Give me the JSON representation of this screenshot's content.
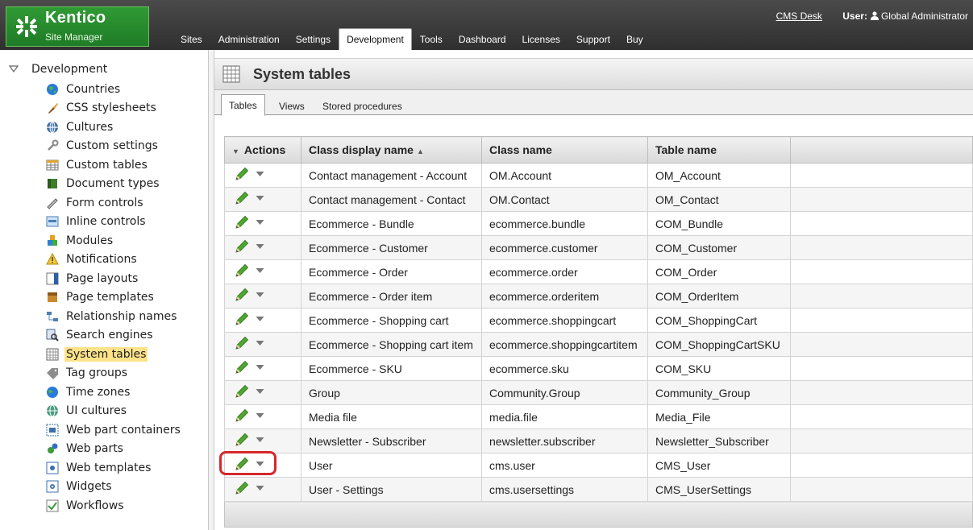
{
  "logo": {
    "title": "Kentico",
    "subtitle": "Site Manager"
  },
  "header": {
    "cms_desk": "CMS Desk",
    "user_label": "User:",
    "user_name": "Global Administrator",
    "nav": [
      {
        "label": "Sites",
        "active": false
      },
      {
        "label": "Administration",
        "active": false
      },
      {
        "label": "Settings",
        "active": false
      },
      {
        "label": "Development",
        "active": true
      },
      {
        "label": "Tools",
        "active": false
      },
      {
        "label": "Dashboard",
        "active": false
      },
      {
        "label": "Licenses",
        "active": false
      },
      {
        "label": "Support",
        "active": false
      },
      {
        "label": "Buy",
        "active": false
      }
    ]
  },
  "tree": {
    "root": "Development",
    "items": [
      {
        "label": "Countries",
        "icon": "globe-icon"
      },
      {
        "label": "CSS stylesheets",
        "icon": "brush-icon"
      },
      {
        "label": "Cultures",
        "icon": "culture-globe-icon"
      },
      {
        "label": "Custom settings",
        "icon": "wrench-icon"
      },
      {
        "label": "Custom tables",
        "icon": "table-icon"
      },
      {
        "label": "Document types",
        "icon": "book-icon"
      },
      {
        "label": "Form controls",
        "icon": "form-icon"
      },
      {
        "label": "Inline controls",
        "icon": "inline-control-icon"
      },
      {
        "label": "Modules",
        "icon": "modules-icon"
      },
      {
        "label": "Notifications",
        "icon": "warning-icon"
      },
      {
        "label": "Page layouts",
        "icon": "layout-icon"
      },
      {
        "label": "Page templates",
        "icon": "template-icon"
      },
      {
        "label": "Relationship names",
        "icon": "relationship-icon"
      },
      {
        "label": "Search engines",
        "icon": "search-engine-icon"
      },
      {
        "label": "System tables",
        "icon": "grid-icon",
        "selected": true
      },
      {
        "label": "Tag groups",
        "icon": "tag-icon"
      },
      {
        "label": "Time zones",
        "icon": "clock-globe-icon"
      },
      {
        "label": "UI cultures",
        "icon": "ui-culture-icon"
      },
      {
        "label": "Web part containers",
        "icon": "container-icon"
      },
      {
        "label": "Web parts",
        "icon": "webpart-icon"
      },
      {
        "label": "Web templates",
        "icon": "web-template-icon"
      },
      {
        "label": "Widgets",
        "icon": "widget-icon"
      },
      {
        "label": "Workflows",
        "icon": "workflow-icon"
      }
    ]
  },
  "page": {
    "title": "System tables"
  },
  "tabs": [
    {
      "label": "Tables",
      "active": true
    },
    {
      "label": "Views",
      "active": false
    },
    {
      "label": "Stored procedures",
      "active": false
    }
  ],
  "grid": {
    "headers": {
      "actions": "Actions",
      "display": "Class display name",
      "class": "Class name",
      "table": "Table name"
    },
    "rows": [
      {
        "display": "Contact management - Account",
        "class": "OM.Account",
        "table": "OM_Account"
      },
      {
        "display": "Contact management - Contact",
        "class": "OM.Contact",
        "table": "OM_Contact"
      },
      {
        "display": "Ecommerce - Bundle",
        "class": "ecommerce.bundle",
        "table": "COM_Bundle"
      },
      {
        "display": "Ecommerce - Customer",
        "class": "ecommerce.customer",
        "table": "COM_Customer"
      },
      {
        "display": "Ecommerce - Order",
        "class": "ecommerce.order",
        "table": "COM_Order"
      },
      {
        "display": "Ecommerce - Order item",
        "class": "ecommerce.orderitem",
        "table": "COM_OrderItem"
      },
      {
        "display": "Ecommerce - Shopping cart",
        "class": "ecommerce.shoppingcart",
        "table": "COM_ShoppingCart"
      },
      {
        "display": "Ecommerce - Shopping cart item",
        "class": "ecommerce.shoppingcartitem",
        "table": "COM_ShoppingCartSKU"
      },
      {
        "display": "Ecommerce - SKU",
        "class": "ecommerce.sku",
        "table": "COM_SKU"
      },
      {
        "display": "Group",
        "class": "Community.Group",
        "table": "Community_Group"
      },
      {
        "display": "Media file",
        "class": "media.file",
        "table": "Media_File"
      },
      {
        "display": "Newsletter - Subscriber",
        "class": "newsletter.subscriber",
        "table": "Newsletter_Subscriber"
      },
      {
        "display": "User",
        "class": "cms.user",
        "table": "CMS_User",
        "highlighted": true
      },
      {
        "display": "User - Settings",
        "class": "cms.usersettings",
        "table": "CMS_UserSettings"
      }
    ]
  },
  "colors": {
    "brand_green": "#2f9a34",
    "header_dark": "#3a3a3a",
    "selected_bg": "#fde28a",
    "highlight_red": "#d6282b"
  }
}
